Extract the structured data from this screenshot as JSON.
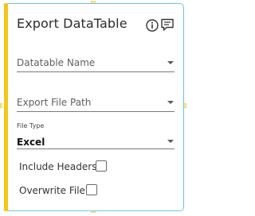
{
  "activity": {
    "title": "Export DataTable",
    "info_icon": "info-icon",
    "comment_icon": "comment-icon",
    "datatable_name": {
      "placeholder": "Datatable Name"
    },
    "export_file_path": {
      "placeholder": "Export File Path"
    },
    "file_type": {
      "label": "File Type",
      "value": "Excel"
    },
    "include_headers": {
      "label": "Include Headers?",
      "checked": false
    },
    "overwrite_file": {
      "label": "Overwrite File?",
      "checked": false
    }
  },
  "colors": {
    "accent": "#f5c518",
    "border": "#6ec3ea"
  }
}
